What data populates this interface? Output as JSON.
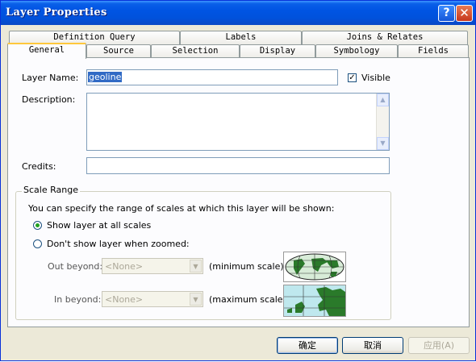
{
  "window": {
    "title": "Layer Properties"
  },
  "tabs_row1": [
    "Definition Query",
    "Labels",
    "Joins & Relates"
  ],
  "tabs_row2": [
    "General",
    "Source",
    "Selection",
    "Display",
    "Symbology",
    "Fields"
  ],
  "general": {
    "layer_name_label": "Layer Name:",
    "layer_name_value": "geoline",
    "visible_label": "Visible",
    "visible_checked": true,
    "description_label": "Description:",
    "description_value": "",
    "credits_label": "Credits:",
    "credits_value": ""
  },
  "scale_range": {
    "title": "Scale Range",
    "intro": "You can specify the range of scales at which this layer will be shown:",
    "option_all": "Show layer at all scales",
    "option_zoomed": "Don't show layer when zoomed:",
    "out_beyond_label": "Out beyond:",
    "out_beyond_value": "<None>",
    "out_beyond_hint": "(minimum scale)",
    "in_beyond_label": "In beyond:",
    "in_beyond_value": "<None>",
    "in_beyond_hint": "(maximum scale)",
    "selected": "all"
  },
  "buttons": {
    "ok": "确定",
    "cancel": "取消",
    "apply": "应用(A)"
  },
  "colors": {
    "title_bar": "#0054e3",
    "selection": "#316ac5",
    "dialog_bg": "#ece9d8"
  }
}
